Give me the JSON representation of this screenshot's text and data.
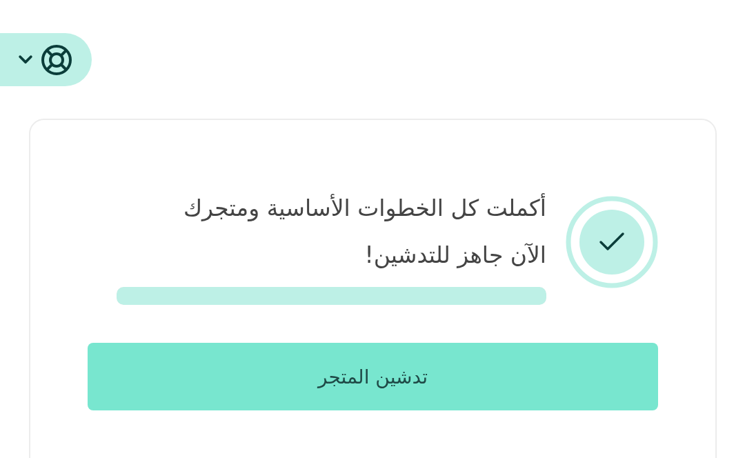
{
  "help_button": {
    "expanded": false
  },
  "setup_card": {
    "completed": true,
    "message": "أكملت كل الخطوات الأساسية ومتجرك الآن جاهز للتدشين!",
    "progress": {
      "level": 1
    },
    "button": "تدشين المتجر"
  }
}
